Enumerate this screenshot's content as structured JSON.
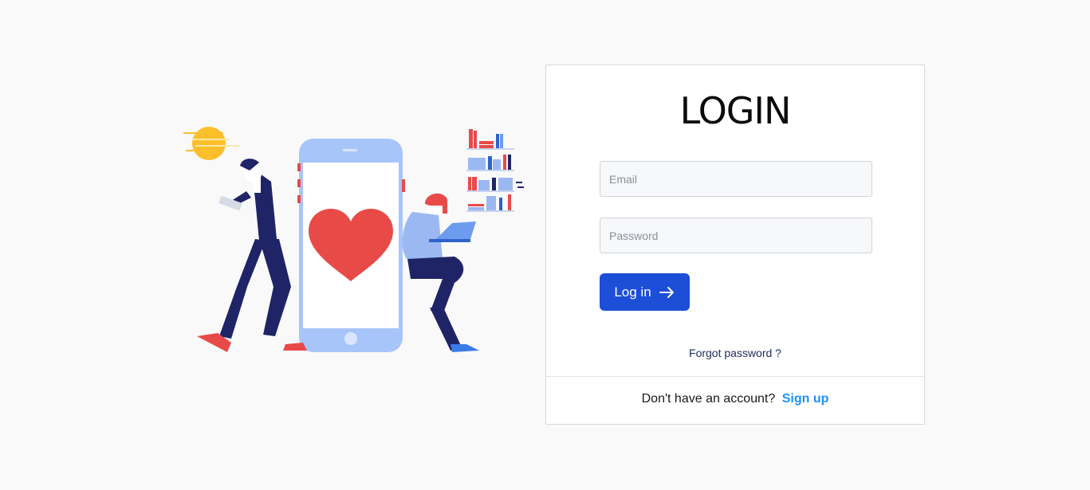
{
  "login_card": {
    "title": "LOGIN",
    "email_placeholder": "Email",
    "email_value": "",
    "password_placeholder": "Password",
    "password_value": "",
    "login_button_label": "Log in",
    "forgot_password_label": "Forgot password ?",
    "no_account_text": "Don't have an account?",
    "signup_label": "Sign up"
  },
  "icons": {
    "login_button_icon": "arrow-right-icon"
  },
  "colors": {
    "background": "#f9f9fa",
    "primary_button": "#1d4ed8",
    "signup_link": "#1e90ff",
    "heart": "#e84a47",
    "phone": "#a8c5fa",
    "figure_dark": "#1e2466",
    "sun": "#fbbf2c"
  }
}
